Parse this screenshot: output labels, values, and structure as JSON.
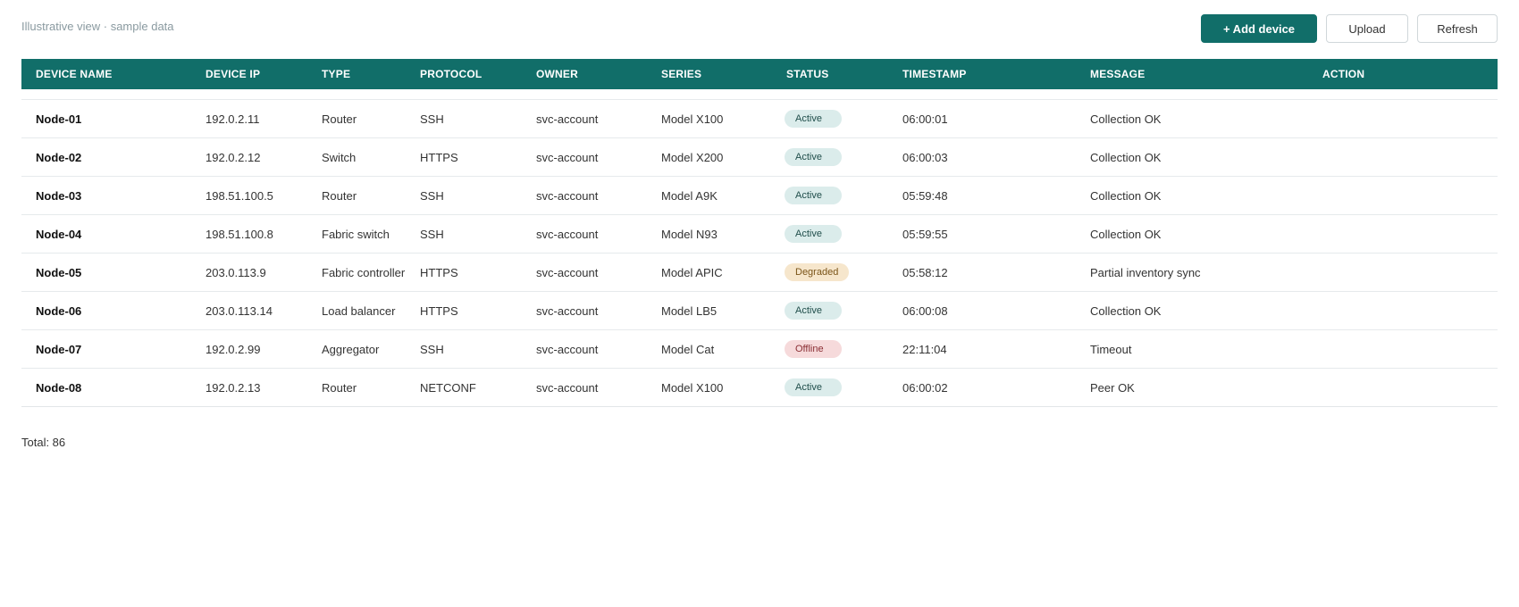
{
  "header": {
    "caption": "Illustrative view · sample data",
    "add_label": "+ Add device",
    "upload_label": "Upload",
    "refresh_label": "Refresh"
  },
  "colors": {
    "accent": "#116e69",
    "status_active_bg": "#dbeceb",
    "status_degraded_bg": "#f6e6cc",
    "status_offline_bg": "#f6dadb"
  },
  "table": {
    "columns": [
      "DEVICE NAME",
      "DEVICE IP",
      "TYPE",
      "PROTOCOL",
      "OWNER",
      "SERIES",
      "STATUS",
      "TIMESTAMP",
      "MESSAGE",
      "ACTION"
    ],
    "rows": [
      {
        "name": "Node-01",
        "ip": "192.0.2.11",
        "type": "Router",
        "protocol": "SSH",
        "owner": "svc-account",
        "series": "Model X100",
        "status": "Active",
        "timestamp": "06:00:01",
        "message": "Collection OK",
        "action": ""
      },
      {
        "name": "Node-02",
        "ip": "192.0.2.12",
        "type": "Switch",
        "protocol": "HTTPS",
        "owner": "svc-account",
        "series": "Model X200",
        "status": "Active",
        "timestamp": "06:00:03",
        "message": "Collection OK",
        "action": ""
      },
      {
        "name": "Node-03",
        "ip": "198.51.100.5",
        "type": "Router",
        "protocol": "SSH",
        "owner": "svc-account",
        "series": "Model A9K",
        "status": "Active",
        "timestamp": "05:59:48",
        "message": "Collection OK",
        "action": ""
      },
      {
        "name": "Node-04",
        "ip": "198.51.100.8",
        "type": "Fabric switch",
        "protocol": "SSH",
        "owner": "svc-account",
        "series": "Model N93",
        "status": "Active",
        "timestamp": "05:59:55",
        "message": "Collection OK",
        "action": ""
      },
      {
        "name": "Node-05",
        "ip": "203.0.113.9",
        "type": "Fabric controller",
        "protocol": "HTTPS",
        "owner": "svc-account",
        "series": "Model APIC",
        "status": "Degraded",
        "timestamp": "05:58:12",
        "message": "Partial inventory sync",
        "action": ""
      },
      {
        "name": "Node-06",
        "ip": "203.0.113.14",
        "type": "Load balancer",
        "protocol": "HTTPS",
        "owner": "svc-account",
        "series": "Model LB5",
        "status": "Active",
        "timestamp": "06:00:08",
        "message": "Collection OK",
        "action": ""
      },
      {
        "name": "Node-07",
        "ip": "192.0.2.99",
        "type": "Aggregator",
        "protocol": "SSH",
        "owner": "svc-account",
        "series": "Model Cat",
        "status": "Offline",
        "timestamp": "22:11:04",
        "message": "Timeout",
        "action": ""
      },
      {
        "name": "Node-08",
        "ip": "192.0.2.13",
        "type": "Router",
        "protocol": "NETCONF",
        "owner": "svc-account",
        "series": "Model X100",
        "status": "Active",
        "timestamp": "06:00:02",
        "message": "Peer OK",
        "action": ""
      }
    ]
  },
  "footer": {
    "total_label": "Total: 86"
  }
}
